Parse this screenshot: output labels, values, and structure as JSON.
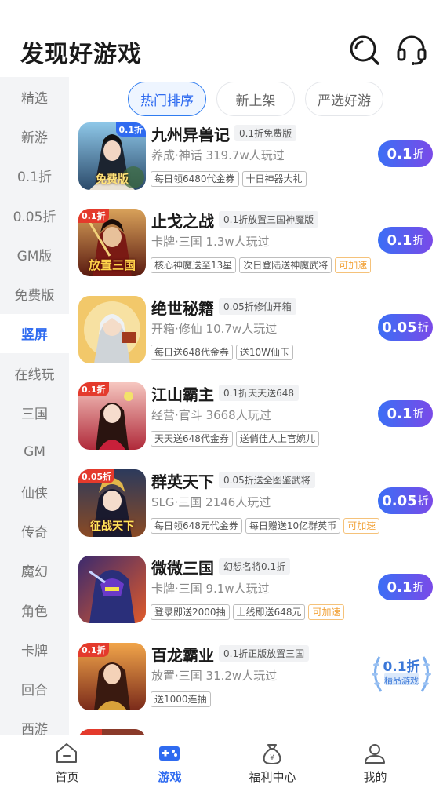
{
  "header": {
    "title": "发现好游戏",
    "search_icon": "search-icon",
    "service_icon": "headset-icon"
  },
  "sidebar": {
    "items": [
      "精选",
      "新游",
      "0.1折",
      "0.05折",
      "GM版",
      "免费版",
      "竖屏",
      "在线玩",
      "三国",
      "GM",
      "仙侠",
      "传奇",
      "魔幻",
      "角色",
      "卡牌",
      "回合",
      "西游"
    ],
    "active": "竖屏"
  },
  "tabs": [
    {
      "label": "热门排序",
      "active": true
    },
    {
      "label": "新上架",
      "active": false
    },
    {
      "label": "严选好游",
      "active": false
    }
  ],
  "games": [
    {
      "name": "九州异兽记",
      "tag": "0.1折免费版",
      "meta": "养成·神话 319.7w人玩过",
      "perks": [
        "每日领6480代金券",
        "十日神器大礼"
      ],
      "speed": "",
      "discount": "0.1",
      "discount_unit": "折",
      "thumb_banner": "0.1折",
      "thumb_caption": "免费版"
    },
    {
      "name": "止戈之战",
      "tag": "0.1折放置三国神魔版",
      "meta": "卡牌·三国 1.3w人玩过",
      "perks": [
        "核心神魔送至13星",
        "次日登陆送神魔武将"
      ],
      "speed": "可加速",
      "discount": "0.1",
      "discount_unit": "折",
      "thumb_banner": "0.1折",
      "thumb_caption": "放置三国"
    },
    {
      "name": "绝世秘籍",
      "tag": "0.05折修仙开箱",
      "meta": "开箱·修仙 10.7w人玩过",
      "perks": [
        "每日送648代金券",
        "送10W仙玉"
      ],
      "speed": "",
      "discount": "0.05",
      "discount_unit": "折",
      "thumb_banner": "",
      "thumb_caption": ""
    },
    {
      "name": "江山霸主",
      "tag": "0.1折天天送648",
      "meta": "经营·官斗 3668人玩过",
      "perks": [
        "天天送648代金券",
        "送俏佳人上官婉儿"
      ],
      "speed": "",
      "discount": "0.1",
      "discount_unit": "折",
      "thumb_banner": "0.1折",
      "thumb_caption": ""
    },
    {
      "name": "群英天下",
      "tag": "0.05折送全图鉴武将",
      "meta": "SLG·三国 2146人玩过",
      "perks": [
        "每日领648元代金券",
        "每日赠送10亿群英币"
      ],
      "speed": "可加速",
      "discount": "0.05",
      "discount_unit": "折",
      "thumb_banner": "0.05折",
      "thumb_caption": "征战天下"
    },
    {
      "name": "微微三国",
      "tag": "幻想名将0.1折",
      "meta": "卡牌·三国 9.1w人玩过",
      "perks": [
        "登录即送2000抽",
        "上线即送648元"
      ],
      "speed": "可加速",
      "discount": "0.1",
      "discount_unit": "折",
      "thumb_banner": "",
      "thumb_caption": ""
    },
    {
      "name": "百龙霸业",
      "tag": "0.1折正版放置三国",
      "meta": "放置·三国 31.2w人玩过",
      "perks": [
        "送1000连抽"
      ],
      "speed": "",
      "discount": "0.1折",
      "discount_unit": "",
      "badge_text": "精品游戏",
      "thumb_banner": "0.1折",
      "thumb_caption": ""
    }
  ],
  "bottom_nav": [
    {
      "label": "首页",
      "icon": "home-icon",
      "active": false
    },
    {
      "label": "游戏",
      "icon": "gamepad-icon",
      "active": true
    },
    {
      "label": "福利中心",
      "icon": "money-bag-icon",
      "active": false
    },
    {
      "label": "我的",
      "icon": "user-icon",
      "active": false
    }
  ],
  "colors": {
    "accent": "#2f6bf0",
    "discount_start": "#3b6ff5",
    "discount_end": "#7a4ae8",
    "speed": "#f2a33a",
    "sidebar_bg": "#f3f4f6"
  }
}
